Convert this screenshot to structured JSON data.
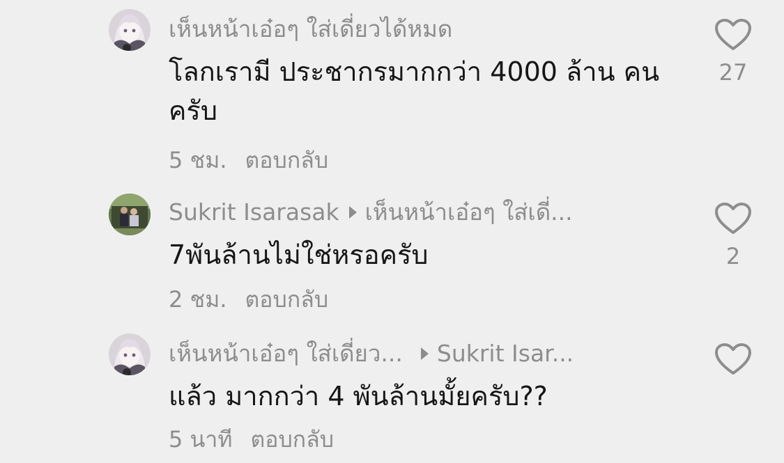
{
  "comments": [
    {
      "author": "เห็นหน้าเอ๋อๆ ใส่เดี่ยวได้หมด",
      "reply_to": "",
      "text": "โลกเรามี ประชากรมากกว่า 4000 ล้าน คนครับ",
      "time": "5 ชม.",
      "reply_label": "ตอบกลับ",
      "likes": "27",
      "avatar_icon": "anime-girl-avatar"
    },
    {
      "author": "Sukrit Isarasak",
      "reply_to": "เห็นหน้าเอ๋อๆ ใส่เดี่...",
      "text": "7พันล้านไม่ใช่หรอครับ",
      "time": "2 ชม.",
      "reply_label": "ตอบกลับ",
      "likes": "2",
      "avatar_icon": "photo-avatar"
    },
    {
      "author": "เห็นหน้าเอ๋อๆ ใส่เดี่ยว...",
      "reply_to": "Sukrit Isar...",
      "text": "แล้ว มากกว่า 4 พันล้านมั้ยครับ??",
      "time": "5 นาที",
      "reply_label": "ตอบกลับ",
      "likes": "",
      "avatar_icon": "anime-girl-avatar"
    }
  ],
  "colors": {
    "background": "#efefef",
    "text": "#161616",
    "muted": "#8d8d8d"
  }
}
